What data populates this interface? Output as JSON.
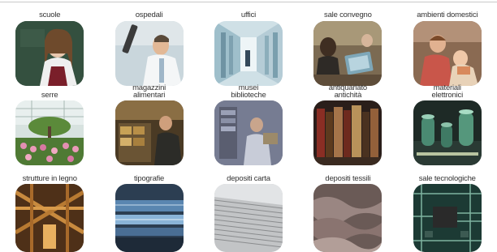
{
  "tiles": [
    {
      "lines": [
        "scuole"
      ],
      "icon": "classroom-girl-image"
    },
    {
      "lines": [
        "ospedali"
      ],
      "icon": "hospital-doctor-image"
    },
    {
      "lines": [
        "uffici"
      ],
      "icon": "office-corridor-image"
    },
    {
      "lines": [
        "sale convegno"
      ],
      "icon": "conference-room-image"
    },
    {
      "lines": [
        "ambienti domestici"
      ],
      "icon": "home-family-image"
    },
    {
      "lines": [
        "serre"
      ],
      "icon": "greenhouse-image"
    },
    {
      "lines": [
        "magazzini",
        "alimentari"
      ],
      "icon": "food-warehouse-image"
    },
    {
      "lines": [
        "musei",
        "biblioteche"
      ],
      "icon": "museum-library-image"
    },
    {
      "lines": [
        "antiquariato",
        "antichità"
      ],
      "icon": "antique-books-image"
    },
    {
      "lines": [
        "materiali",
        "elettronici"
      ],
      "icon": "electronic-components-image"
    },
    {
      "lines": [
        "strutture in legno"
      ],
      "icon": "wooden-structure-image"
    },
    {
      "lines": [
        "tipografie"
      ],
      "icon": "printing-press-image"
    },
    {
      "lines": [
        "depositi carta"
      ],
      "icon": "paper-stack-image"
    },
    {
      "lines": [
        "depositi tessili"
      ],
      "icon": "textile-fabric-image"
    },
    {
      "lines": [
        "sale tecnologiche"
      ],
      "icon": "circuit-board-image"
    }
  ]
}
